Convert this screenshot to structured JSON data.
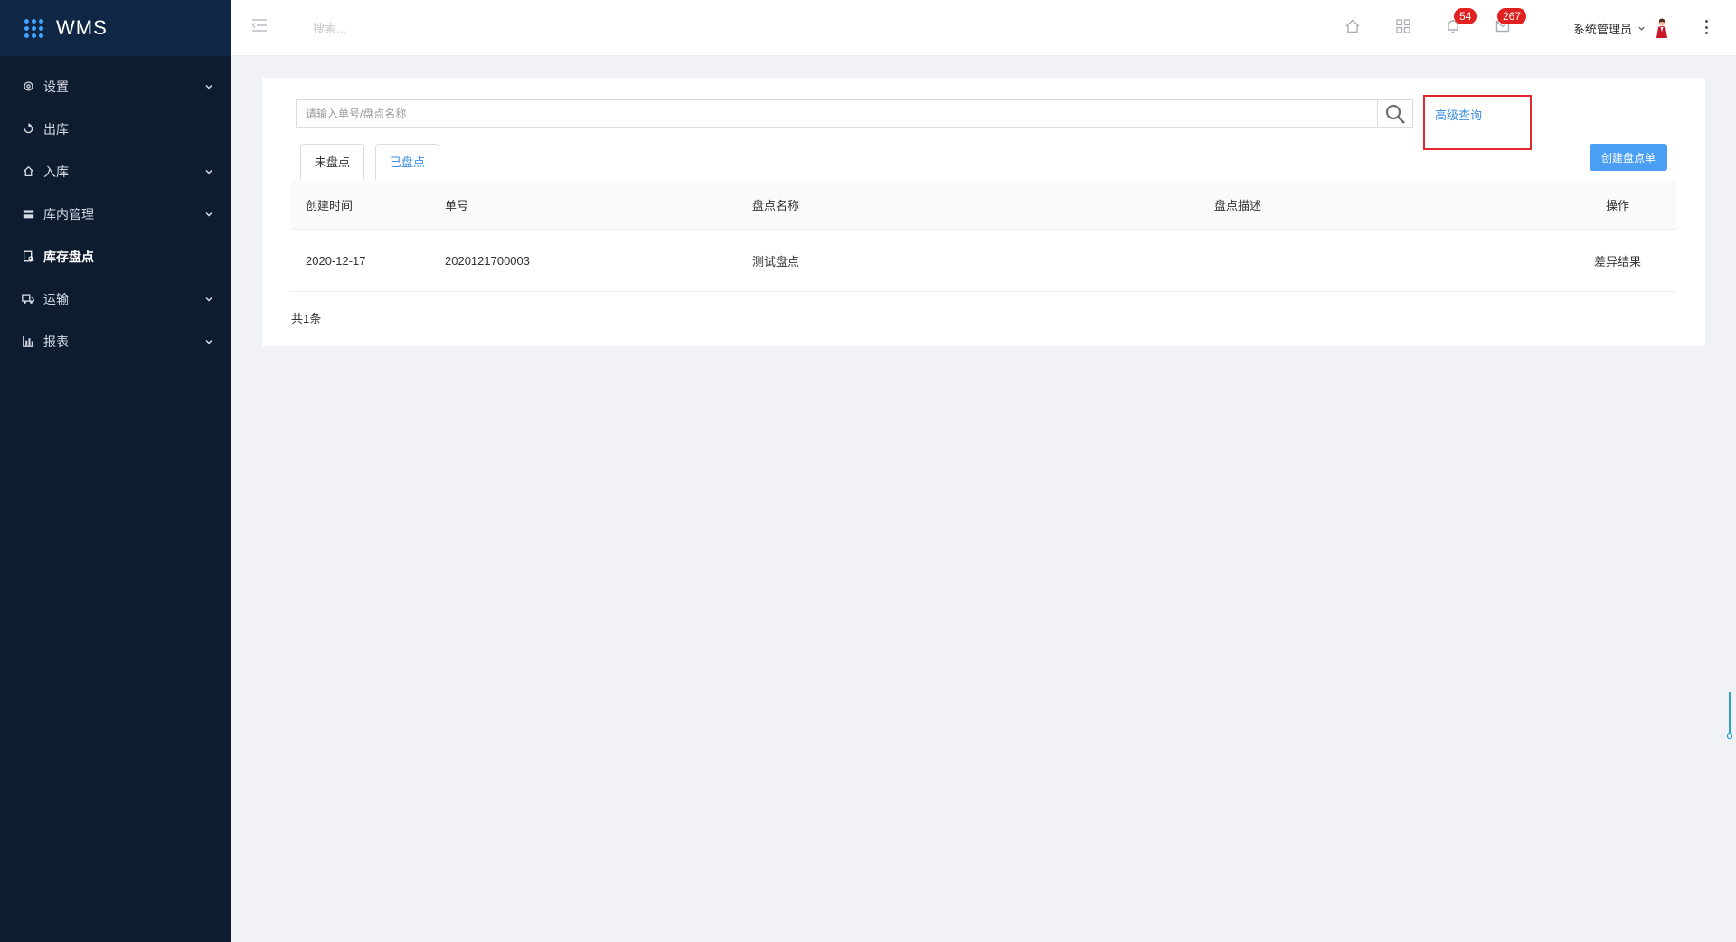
{
  "app": {
    "name": "WMS"
  },
  "sidebar": {
    "items": [
      {
        "label": "设置",
        "icon": "gear-icon",
        "expandable": true
      },
      {
        "label": "出库",
        "icon": "export-icon",
        "expandable": false
      },
      {
        "label": "入库",
        "icon": "import-icon",
        "expandable": true
      },
      {
        "label": "库内管理",
        "icon": "warehouse-icon",
        "expandable": true
      },
      {
        "label": "库存盘点",
        "icon": "inventory-icon",
        "expandable": false,
        "active": true
      },
      {
        "label": "运输",
        "icon": "truck-icon",
        "expandable": true
      },
      {
        "label": "报表",
        "icon": "bar-chart-icon",
        "expandable": true
      }
    ]
  },
  "header": {
    "search_placeholder": "搜索...",
    "notifications_count": "54",
    "messages_count": "267",
    "user_name": "系统管理员"
  },
  "main": {
    "search_placeholder": "请输入单号/盘点名称",
    "advanced_search": "高级查询",
    "tabs": [
      {
        "label": "未盘点"
      },
      {
        "label": "已盘点"
      }
    ],
    "create_button": "创建盘点单",
    "table": {
      "columns": [
        "创建时间",
        "单号",
        "盘点名称",
        "盘点描述",
        "操作"
      ],
      "rows": [
        {
          "created": "2020-12-17",
          "order_no": "2020121700003",
          "name": "测试盘点",
          "description": "",
          "action": "差异结果"
        }
      ]
    },
    "total": "共1条"
  },
  "colors": {
    "sidebar_bg": "#0e1c30",
    "accent": "#4a9ff5",
    "badge": "#e1211f",
    "highlight_box": "#e3262f"
  }
}
